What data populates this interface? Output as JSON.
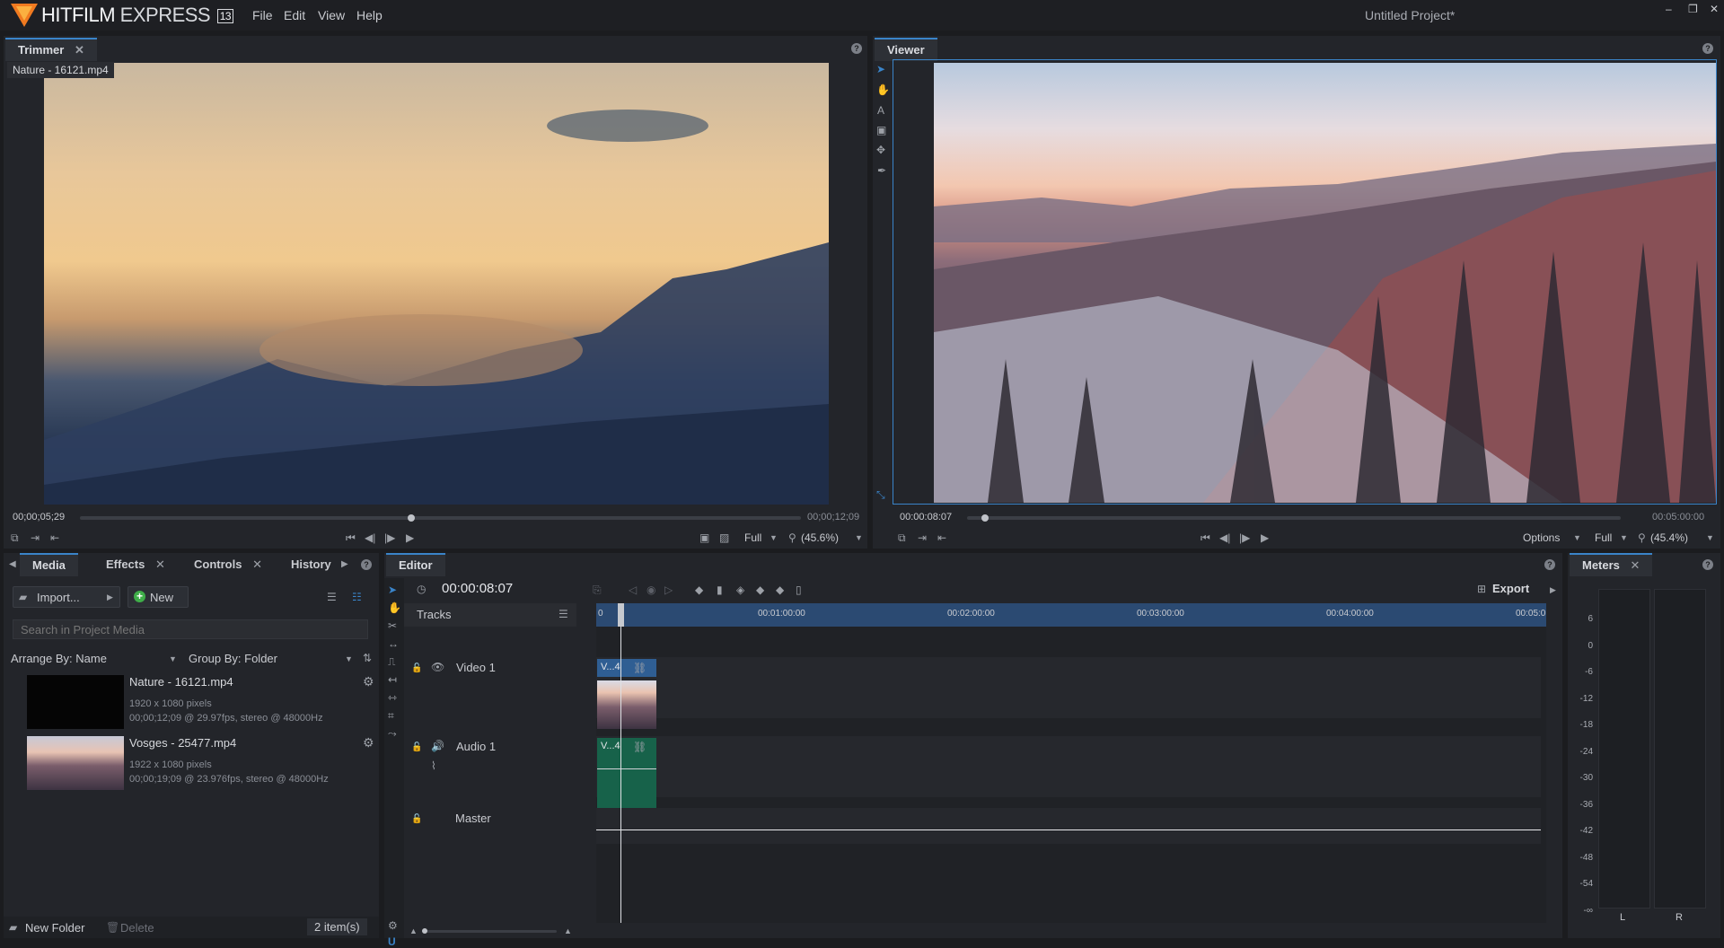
{
  "app": {
    "name_bold": "HITFILM",
    "name_light": " EXPRESS",
    "version": "13",
    "project_title": "Untitled Project*",
    "menu": [
      "File",
      "Edit",
      "View",
      "Help"
    ],
    "window_controls": [
      "–",
      "❐",
      "✕"
    ]
  },
  "trimmer": {
    "tab": "Trimmer",
    "clip_label": "Nature - 16121.mp4",
    "timecode_current": "00;00;05;29",
    "timecode_end": "00;00;12;09",
    "position": 0.46,
    "quality": "Full",
    "zoom": "(45.6%)"
  },
  "viewer": {
    "tab": "Viewer",
    "timecode_current": "00:00:08:07",
    "timecode_end": "00:05:00:00",
    "position": 0.027,
    "options": "Options",
    "quality": "Full",
    "zoom": "(45.4%)"
  },
  "media_panel": {
    "tabs": [
      "Media",
      "Effects",
      "Controls",
      "History"
    ],
    "import_label": "Import...",
    "new_label": "New",
    "search_placeholder": "Search in Project Media",
    "arrange_label": "Arrange By: Name",
    "group_label": "Group By: Folder",
    "items": [
      {
        "name": "Nature - 16121.mp4",
        "dims": "1920 x 1080 pixels",
        "info": "00;00;12;09 @ 29.97fps, stereo @ 48000Hz"
      },
      {
        "name": "Vosges - 25477.mp4",
        "dims": "1922 x 1080 pixels",
        "info": "00;00;19;09 @ 23.976fps, stereo @ 48000Hz"
      }
    ],
    "new_folder_label": "New Folder",
    "delete_label": "Delete",
    "item_count": "2 item(s)"
  },
  "editor": {
    "tab": "Editor",
    "timecode": "00:00:08:07",
    "export_label": "Export",
    "tracks_label": "Tracks",
    "ruler_labels": [
      "0",
      "00:01:00:00",
      "00:02:00:00",
      "00:03:00:00",
      "00:04:00:00",
      "00:05:0"
    ],
    "video_track": "Video 1",
    "audio_track": "Audio 1",
    "master_track": "Master",
    "video_clip_label": "V...4",
    "audio_clip_label": "V...4"
  },
  "meters": {
    "tab": "Meters",
    "scale": [
      "6",
      "0",
      "-6",
      "-12",
      "-18",
      "-24",
      "-30",
      "-36",
      "-42",
      "-48",
      "-54",
      "-∞"
    ],
    "channels": [
      "L",
      "R"
    ]
  },
  "colors": {
    "accent": "#3a84c9",
    "audio_clip": "#17624a",
    "video_clip_header": "#2f5e93",
    "logo": "#f07a20"
  }
}
